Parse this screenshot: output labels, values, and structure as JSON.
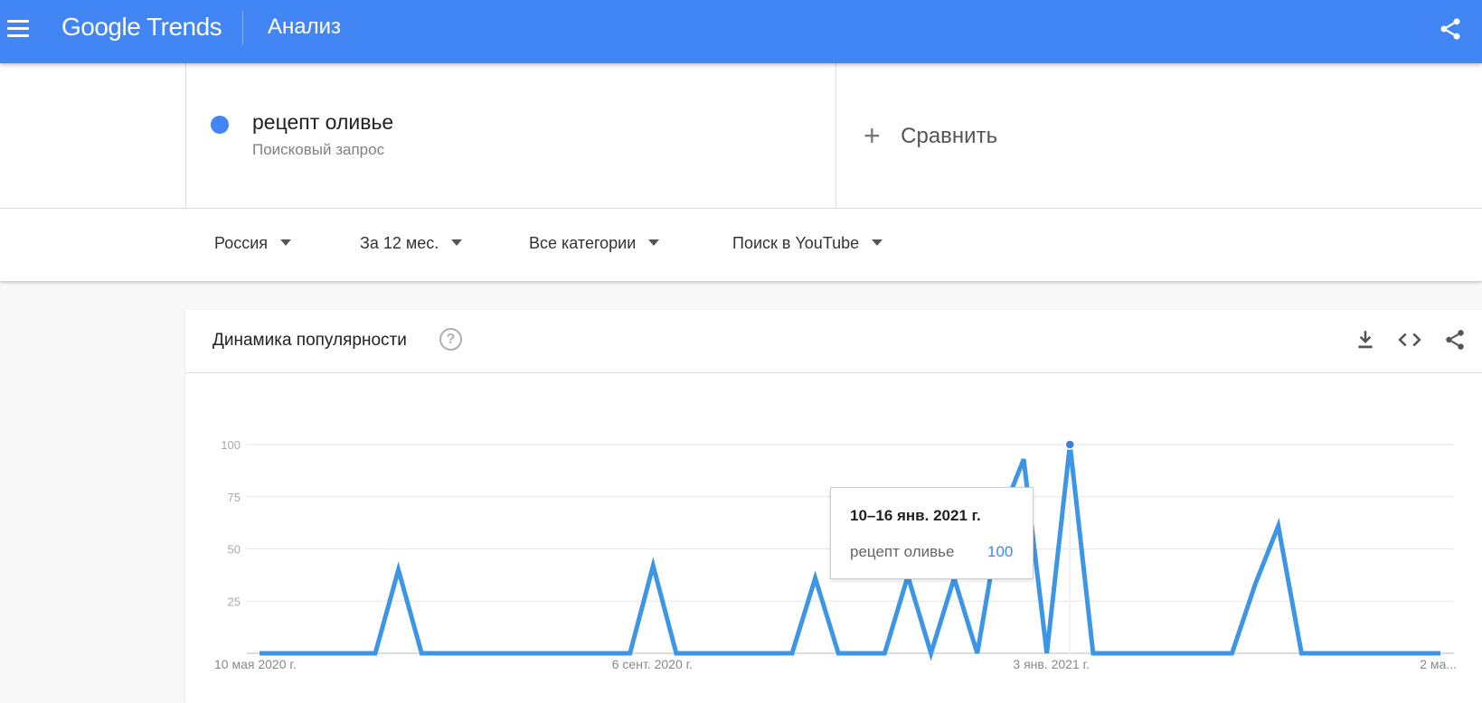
{
  "app": {
    "brand": "Google Trends",
    "page_title": "Анализ"
  },
  "query": {
    "term": "рецепт оливье",
    "term_type": "Поисковый запрос",
    "term_color": "#4285f4",
    "compare_label": "Сравнить"
  },
  "filters": {
    "region": "Россия",
    "period": "За 12 мес.",
    "category": "Все категории",
    "source": "Поиск в YouTube"
  },
  "card": {
    "title": "Динамика популярности",
    "help_icon": "help-icon",
    "download_icon": "download-icon",
    "embed_icon": "embed-icon",
    "share_icon": "share-icon"
  },
  "tooltip": {
    "date": "10–16 янв. 2021 г.",
    "term": "рецепт оливье",
    "value": "100"
  },
  "colors": {
    "header_bg": "#4285f4",
    "series": "#3d96e5"
  },
  "chart_data": {
    "type": "line",
    "title": "Динамика популярности",
    "ylim": [
      0,
      100
    ],
    "y_ticks": [
      25,
      50,
      75,
      100
    ],
    "x_tick_labels": [
      "10 мая 2020 г.",
      "6 сент. 2020 г.",
      "3 янв. 2021 г.",
      "2 ма..."
    ],
    "grid": true,
    "series": [
      {
        "name": "рецепт оливье",
        "values": [
          0,
          0,
          0,
          0,
          0,
          0,
          40,
          0,
          0,
          0,
          0,
          0,
          0,
          0,
          0,
          0,
          0,
          42,
          0,
          0,
          0,
          0,
          0,
          0,
          36,
          0,
          0,
          0,
          37,
          0,
          36,
          0,
          65,
          93,
          0,
          100,
          0,
          0,
          0,
          0,
          0,
          0,
          0,
          33,
          61,
          0,
          0,
          0,
          0,
          0,
          0,
          0
        ]
      }
    ],
    "highlight": {
      "index": 35,
      "value": 100,
      "label": "10–16 янв. 2021 г."
    }
  }
}
